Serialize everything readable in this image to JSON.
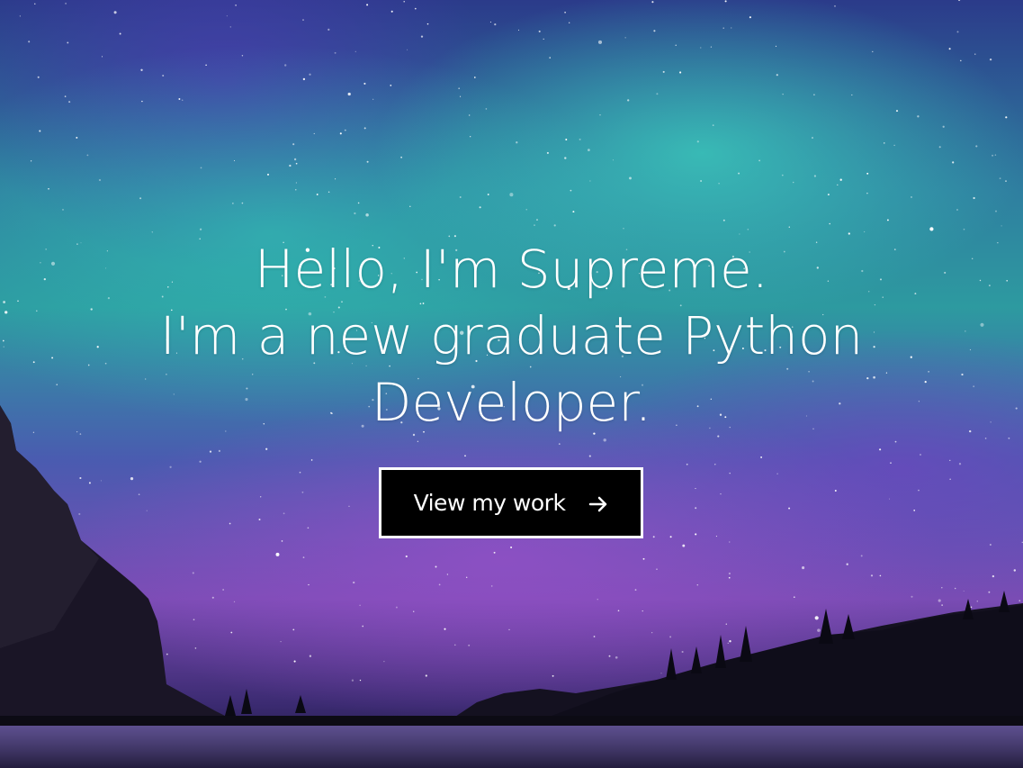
{
  "hero": {
    "line1": "Hello, I'm Supreme.",
    "line2": "I'm a new graduate Python",
    "line3": "Developer."
  },
  "cta": {
    "label": "View my work",
    "icon": "arrow-right-icon"
  },
  "colors": {
    "text": "#ffffff",
    "button_bg": "#000000",
    "button_border": "#ffffff"
  }
}
